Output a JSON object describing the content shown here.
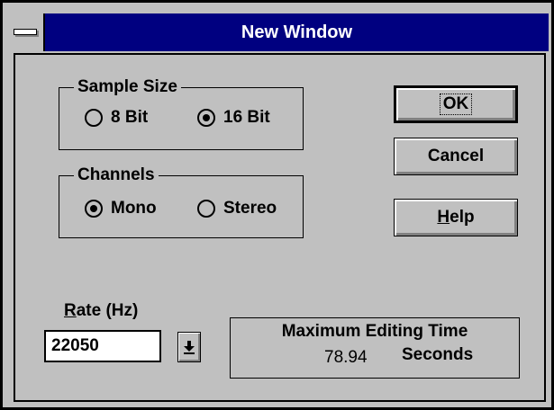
{
  "window": {
    "title": "New Window"
  },
  "sample_size": {
    "label": "Sample Size",
    "options": [
      {
        "label": "8 Bit",
        "selected": false
      },
      {
        "label": "16 Bit",
        "selected": true
      }
    ]
  },
  "channels": {
    "label": "Channels",
    "options": [
      {
        "label": "Mono",
        "selected": true
      },
      {
        "label": "Stereo",
        "selected": false
      }
    ]
  },
  "buttons": {
    "ok_label": "OK",
    "cancel_label": "Cancel",
    "help_label": "Help",
    "help_mnemonic": "H",
    "help_rest": "elp"
  },
  "rate": {
    "label": "Rate (Hz)",
    "mnemonic": "R",
    "label_rest": "ate (Hz)",
    "value": "22050"
  },
  "editing_time": {
    "label": "Maximum Editing Time",
    "value": "78.94",
    "unit": "Seconds"
  },
  "icons": {
    "system_menu": "system-menu-icon",
    "dropdown": "down-arrow-icon"
  },
  "colors": {
    "title_bar": "#000080",
    "face": "#c0c0c0",
    "input_bg": "#ffffff"
  }
}
